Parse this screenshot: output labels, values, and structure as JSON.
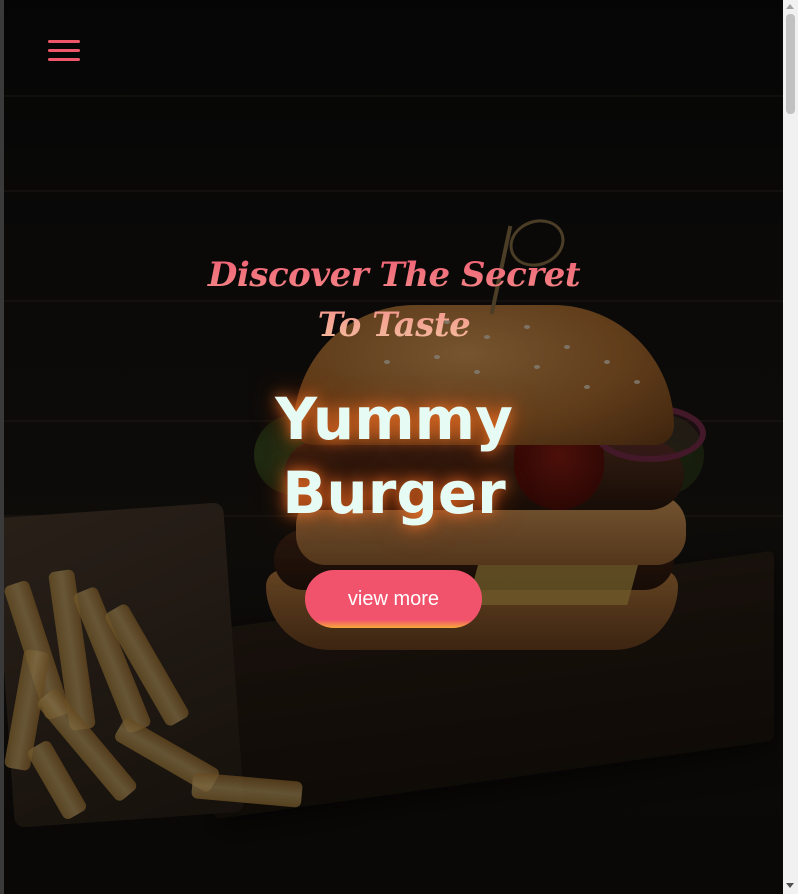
{
  "nav": {
    "menu_icon": "hamburger-menu-icon",
    "accent_color": "#f0566a"
  },
  "hero": {
    "tagline": "Discover The Secret To Taste",
    "headline_line1": "Yummy",
    "headline_line2": "Burger",
    "cta_label": "view more",
    "background_image": "burger-and-fries-photo",
    "cta_color": "#f2536c",
    "cta_accent": "#f6a93a",
    "headline_color": "#e6fbf4"
  },
  "scrollbar": {
    "up_icon": "scroll-up-arrow-icon",
    "down_icon": "scroll-down-arrow-icon"
  }
}
